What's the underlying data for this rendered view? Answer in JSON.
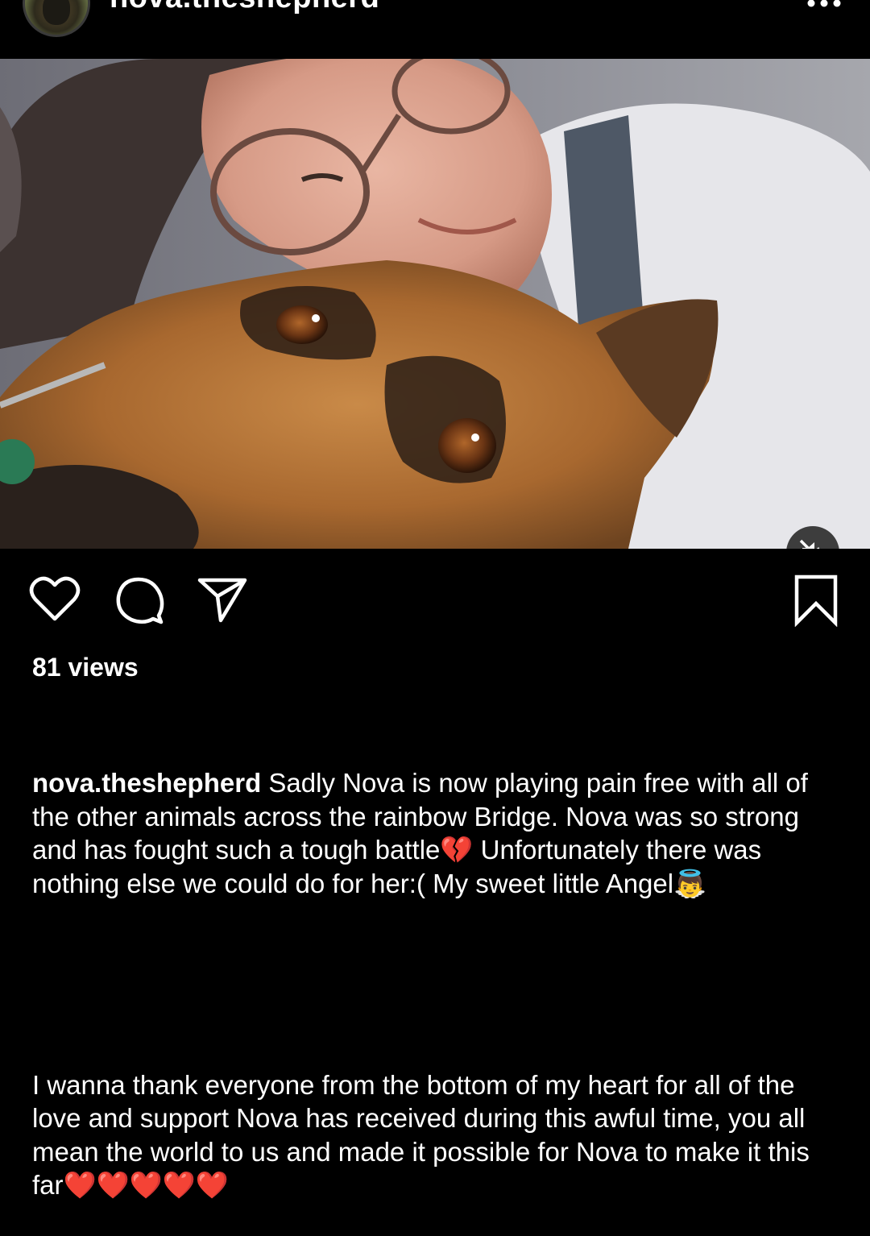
{
  "header": {
    "username": "nova.theshepherd",
    "more_icon": "more-horizontal-icon"
  },
  "media": {
    "type": "video",
    "description_icon": "video-frame",
    "mute_icon": "speaker-muted-icon"
  },
  "actions": {
    "like_icon": "heart-icon",
    "comment_icon": "comment-bubble-icon",
    "share_icon": "paper-plane-icon",
    "save_icon": "bookmark-icon"
  },
  "views": "81 views",
  "caption": {
    "username": "nova.theshepherd",
    "paragraph1": "Sadly Nova is now playing pain free with all of the other animals across the rainbow Bridge. Nova was so strong and has fought such a tough battle💔 Unfortunately there was nothing else we could do for her:( My sweet little Angel👼",
    "paragraph2": "I wanna thank everyone from the bottom of my heart for all of the love and support Nova has received during this awful time, you all mean the world to us and made it possible for Nova to make it this far❤️❤️❤️❤️❤️"
  },
  "colors": {
    "background": "#000000",
    "text": "#ffffff"
  }
}
